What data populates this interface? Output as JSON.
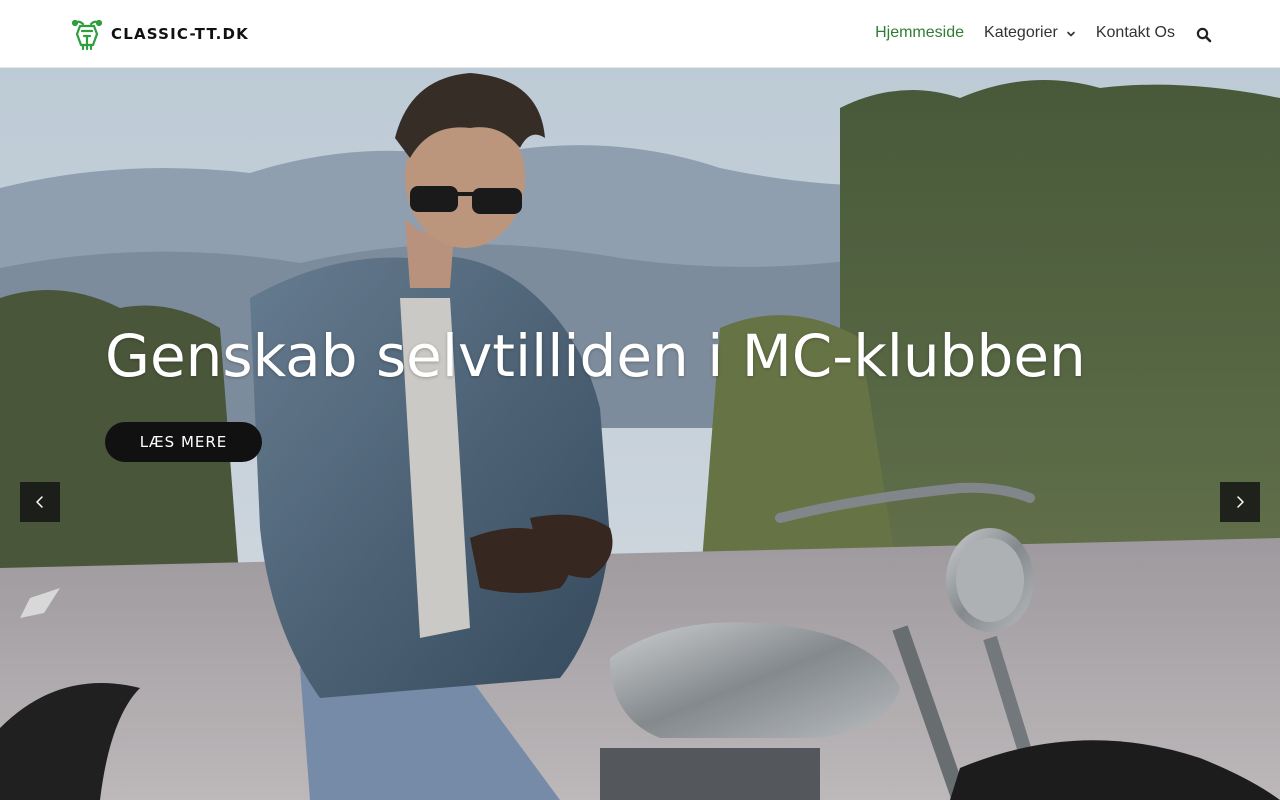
{
  "header": {
    "logo_text": "CLASSIC-TT.DK",
    "logo_icon": "motorcycle-head-icon",
    "nav": [
      {
        "label": "Hjemmeside",
        "active": true
      },
      {
        "label": "Kategorier",
        "has_dropdown": true
      },
      {
        "label": "Kontakt Os"
      }
    ],
    "search_icon": "search-icon",
    "accent_color": "#2e7d32"
  },
  "hero": {
    "title": "Genskab selvtilliden i MC-klubben",
    "cta_label": "LÆS MERE",
    "prev_icon": "chevron-left-icon",
    "next_icon": "chevron-right-icon"
  }
}
